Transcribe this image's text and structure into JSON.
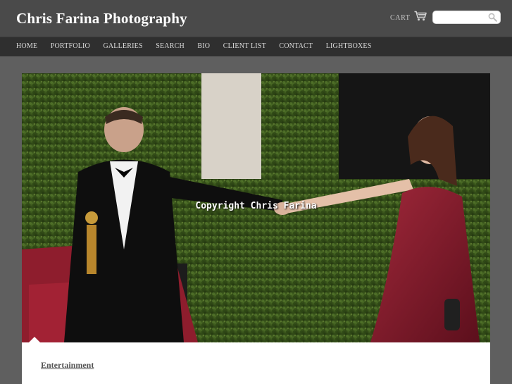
{
  "site": {
    "title": "Chris Farina Photography"
  },
  "header": {
    "cart_label": "CART",
    "cart_icon": "shopping-cart-icon",
    "search": {
      "value": "",
      "placeholder": "",
      "icon": "magnifier-icon"
    }
  },
  "nav": {
    "items": [
      {
        "label": "HOME"
      },
      {
        "label": "PORTFOLIO"
      },
      {
        "label": "GALLERIES"
      },
      {
        "label": "SEARCH"
      },
      {
        "label": "BIO"
      },
      {
        "label": "CLIENT LIST"
      },
      {
        "label": "CONTACT"
      },
      {
        "label": "LIGHTBOXES"
      }
    ]
  },
  "photo": {
    "watermark": "Copyright Chris Farina"
  },
  "caption": {
    "category": "Entertainment"
  },
  "colors": {
    "page_bg": "#5f5f5f",
    "header_bg": "#4a4a4a",
    "nav_bg": "#2f2f2f",
    "accent_red": "#8e1d2d"
  }
}
